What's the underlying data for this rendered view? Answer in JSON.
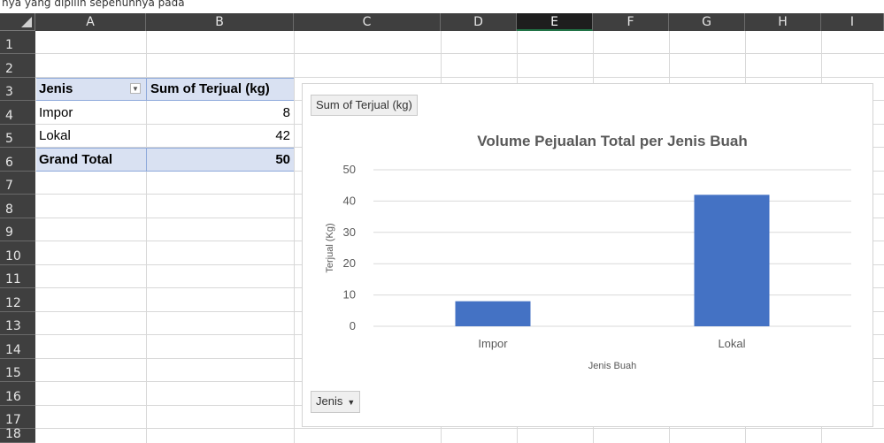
{
  "top_text": "nya yang dipilih sepenuhnya pada",
  "columns": [
    "A",
    "B",
    "C",
    "D",
    "E",
    "F",
    "G",
    "H",
    "I"
  ],
  "selected_column": "E",
  "rows": [
    "1",
    "2",
    "3",
    "4",
    "5",
    "6",
    "7",
    "8",
    "9",
    "10",
    "11",
    "12",
    "13",
    "14",
    "15",
    "16",
    "17",
    "18"
  ],
  "pivot": {
    "header": {
      "field": "Jenis",
      "value": "Sum of Terjual (kg)"
    },
    "rows": [
      {
        "label": "Impor",
        "value": "8"
      },
      {
        "label": "Lokal",
        "value": "42"
      }
    ],
    "total": {
      "label": "Grand Total",
      "value": "50"
    }
  },
  "chart_buttons": {
    "values_field": "Sum of Terjual (kg)",
    "axis_field": "Jenis",
    "dropdown_glyph": "▼"
  },
  "chart_data": {
    "type": "bar",
    "title": "Volume Pejualan Total per Jenis Buah",
    "xlabel": "Jenis Buah",
    "ylabel": "Terjual (Kg)",
    "categories": [
      "Impor",
      "Lokal"
    ],
    "values": [
      8,
      42
    ],
    "ylim": [
      0,
      50
    ],
    "yticks": [
      0,
      10,
      20,
      30,
      40,
      50
    ],
    "grid": true,
    "bar_color": "#4472c4"
  },
  "colors": {
    "header_bg": "#3f3f3f",
    "pivot_fill": "#d9e1f2",
    "grid": "#d8d8d8"
  }
}
